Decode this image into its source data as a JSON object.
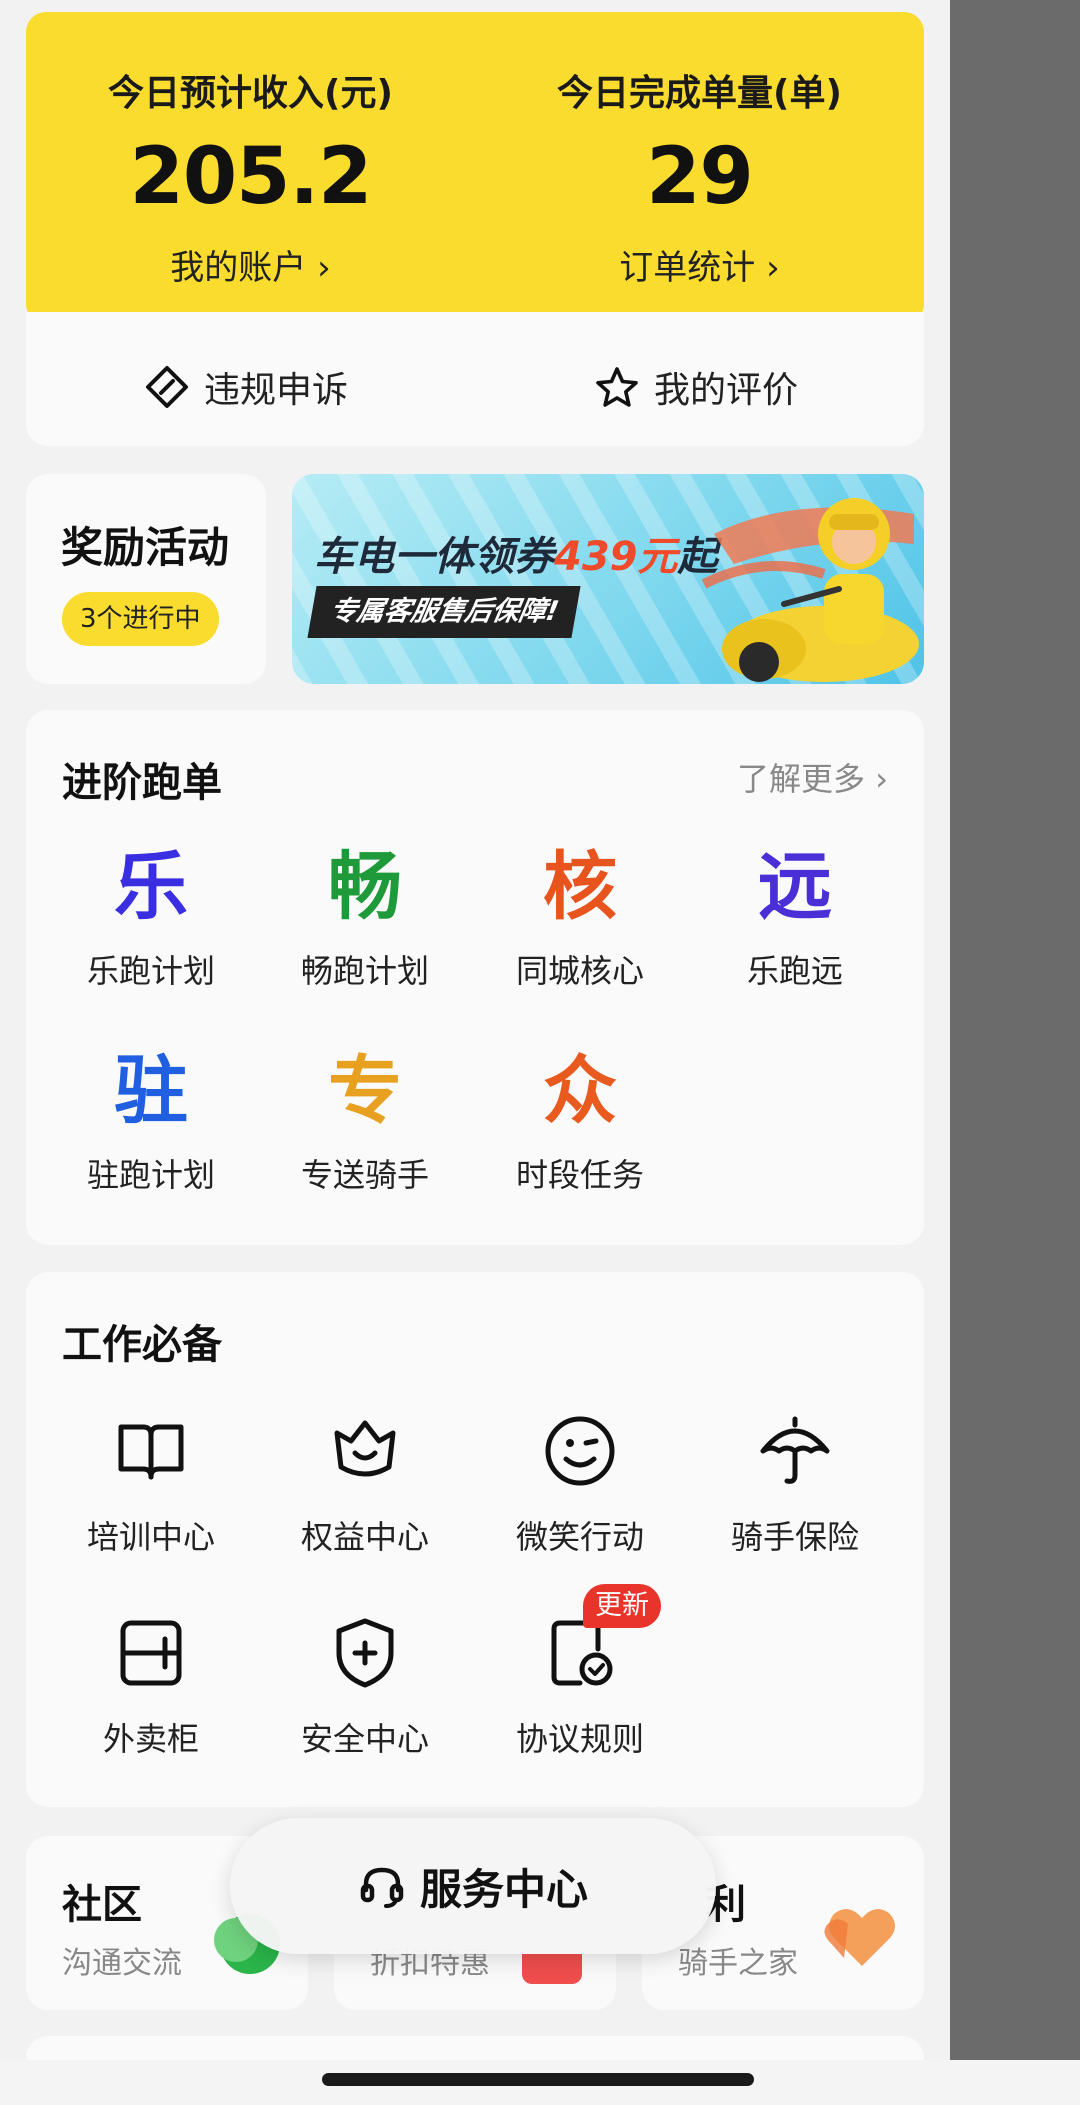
{
  "stats": {
    "income_label": "今日预计收入(元)",
    "income_value": "205.2",
    "income_link": "我的账户 ›",
    "orders_label": "今日完成单量(单)",
    "orders_value": "29",
    "orders_link": "订单统计 ›"
  },
  "quick_actions": {
    "appeal": "违规申诉",
    "rating": "我的评价"
  },
  "reward": {
    "title": "奖励活动",
    "badge": "3个进行中"
  },
  "banner": {
    "headline_prefix": "车电一体领券",
    "headline_price": "439元",
    "headline_suffix": "起",
    "subline": "专属客服售后保障!"
  },
  "advanced": {
    "title": "进阶跑单",
    "more": "了解更多 ›",
    "items": [
      {
        "glyph": "乐",
        "label": "乐跑计划",
        "color": "#3a2fe0"
      },
      {
        "glyph": "畅",
        "label": "畅跑计划",
        "color": "#1f9a3a"
      },
      {
        "glyph": "核",
        "label": "同城核心",
        "color": "#e8541e"
      },
      {
        "glyph": "远",
        "label": "乐跑远",
        "color": "#4b2fd6"
      },
      {
        "glyph": "驻",
        "label": "驻跑计划",
        "color": "#1f5fe0"
      },
      {
        "glyph": "专",
        "label": "专送骑手",
        "color": "#e8a020"
      },
      {
        "glyph": "众",
        "label": "时段任务",
        "color": "#e85a1e"
      }
    ]
  },
  "tools": {
    "title": "工作必备",
    "items": [
      {
        "label": "培训中心",
        "icon": "book-icon"
      },
      {
        "label": "权益中心",
        "icon": "crown-icon"
      },
      {
        "label": "微笑行动",
        "icon": "smile-icon"
      },
      {
        "label": "骑手保险",
        "icon": "umbrella-icon"
      },
      {
        "label": "外卖柜",
        "icon": "cabinet-icon"
      },
      {
        "label": "安全中心",
        "icon": "shield-icon"
      },
      {
        "label": "协议规则",
        "icon": "agreement-icon",
        "badge": "更新"
      }
    ]
  },
  "bottom_cards": {
    "community_title": "社区",
    "community_sub": "沟通交流",
    "discount_sub": "折扣特惠",
    "welfare_title": "利",
    "welfare_sub": "骑手之家"
  },
  "service": {
    "label": "服务中心"
  }
}
